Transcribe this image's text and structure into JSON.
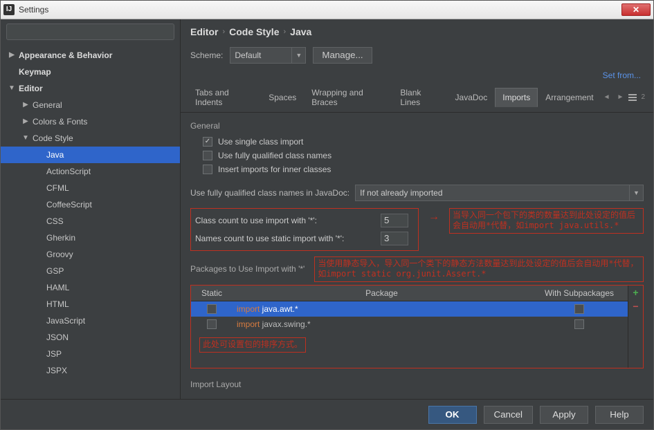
{
  "window": {
    "title": "Settings"
  },
  "search": {
    "placeholder": ""
  },
  "sidebar": {
    "items": [
      {
        "label": "Appearance & Behavior",
        "level": 0,
        "hasChildren": true,
        "expanded": false
      },
      {
        "label": "Keymap",
        "level": 0,
        "hasChildren": false
      },
      {
        "label": "Editor",
        "level": 0,
        "hasChildren": true,
        "expanded": true
      },
      {
        "label": "General",
        "level": 1,
        "hasChildren": true,
        "expanded": false
      },
      {
        "label": "Colors & Fonts",
        "level": 1,
        "hasChildren": true,
        "expanded": false
      },
      {
        "label": "Code Style",
        "level": 1,
        "hasChildren": true,
        "expanded": true
      },
      {
        "label": "Java",
        "level": 2,
        "selected": true
      },
      {
        "label": "ActionScript",
        "level": 2
      },
      {
        "label": "CFML",
        "level": 2
      },
      {
        "label": "CoffeeScript",
        "level": 2
      },
      {
        "label": "CSS",
        "level": 2
      },
      {
        "label": "Gherkin",
        "level": 2
      },
      {
        "label": "Groovy",
        "level": 2
      },
      {
        "label": "GSP",
        "level": 2
      },
      {
        "label": "HAML",
        "level": 2
      },
      {
        "label": "HTML",
        "level": 2
      },
      {
        "label": "JavaScript",
        "level": 2
      },
      {
        "label": "JSON",
        "level": 2
      },
      {
        "label": "JSP",
        "level": 2
      },
      {
        "label": "JSPX",
        "level": 2
      }
    ]
  },
  "breadcrumb": [
    "Editor",
    "Code Style",
    "Java"
  ],
  "scheme": {
    "label": "Scheme:",
    "value": "Default",
    "manage": "Manage...",
    "setFrom": "Set from..."
  },
  "tabs": [
    "Tabs and Indents",
    "Spaces",
    "Wrapping and Braces",
    "Blank Lines",
    "JavaDoc",
    "Imports",
    "Arrangement"
  ],
  "activeTab": "Imports",
  "tabCount": "2",
  "general": {
    "title": "General",
    "singleClass": {
      "label": "Use single class import",
      "checked": true
    },
    "fqn": {
      "label": "Use fully qualified class names",
      "checked": false
    },
    "inner": {
      "label": "Insert imports for inner classes",
      "checked": false
    }
  },
  "javadoc": {
    "label": "Use fully qualified class names in JavaDoc:",
    "value": "If not already imported"
  },
  "counts": {
    "classCount": {
      "label": "Class count to use import with '*':",
      "value": "5"
    },
    "namesCount": {
      "label": "Names count to use static import with '*':",
      "value": "3"
    }
  },
  "annotations": {
    "countNote": "当导入同一个包下的类的数量达到此处设定的值后会自动用*代替，如import java.utils.*",
    "staticNote": "当使用静态导入，导入同一个类下的静态方法数量达到此处设定的值后会自动用*代替，如import static org.junit.Assert.*",
    "orderNote": "此处可设置包的排序方式。"
  },
  "packages": {
    "title": "Packages to Use Import with '*'",
    "headers": {
      "static": "Static",
      "package": "Package",
      "sub": "With Subpackages"
    },
    "rows": [
      {
        "staticChecked": false,
        "keyword": "import",
        "text": " java.awt.*",
        "subChecked": false,
        "selected": true
      },
      {
        "staticChecked": false,
        "keyword": "import",
        "text": " javax.swing.*",
        "subChecked": false,
        "selected": false
      }
    ]
  },
  "importLayout": {
    "title": "Import Layout"
  },
  "buttons": {
    "ok": "OK",
    "cancel": "Cancel",
    "apply": "Apply",
    "help": "Help"
  }
}
